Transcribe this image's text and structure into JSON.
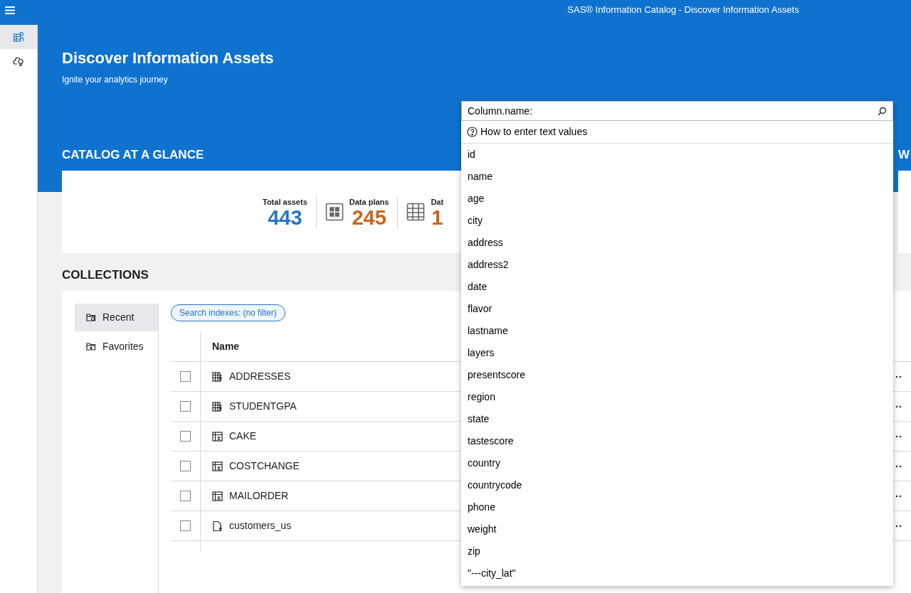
{
  "app_title": "SAS® Information Catalog - Discover Information Assets",
  "rail": [
    {
      "kind": "catalog",
      "selected": true
    },
    {
      "kind": "insight",
      "selected": false
    }
  ],
  "hero": {
    "title": "Discover Information Assets",
    "subtitle": "Ignite your analytics journey"
  },
  "glance": {
    "heading": "CATALOG AT A GLANCE",
    "stats": [
      {
        "label": "Total assets",
        "value": "443",
        "kind": "total"
      },
      {
        "label": "Data plans",
        "value": "245",
        "kind": "plans"
      },
      {
        "label": "Dat",
        "value": "1",
        "kind": "tables"
      }
    ]
  },
  "side_panel": {
    "heading": "W"
  },
  "collections": {
    "heading": "COLLECTIONS",
    "nav": [
      {
        "label": "Recent",
        "kind": "recent",
        "selected": true
      },
      {
        "label": "Favorites",
        "kind": "favorites",
        "selected": false
      }
    ],
    "filter_chip": "Search indexes: (no filter)",
    "table": {
      "columns": [
        "Name"
      ],
      "rows": [
        {
          "name": "ADDRESSES",
          "kind": "table-bolt",
          "checked": false
        },
        {
          "name": "STUDENTGPA",
          "kind": "table-bolt",
          "checked": false
        },
        {
          "name": "CAKE",
          "kind": "table-grid",
          "checked": false
        },
        {
          "name": "COSTCHANGE",
          "kind": "table-grid",
          "checked": false
        },
        {
          "name": "MAILORDER",
          "kind": "table-grid",
          "checked": false
        },
        {
          "name": "customers_us",
          "kind": "file",
          "checked": false
        }
      ]
    }
  },
  "search": {
    "value": "Column.name:",
    "help": "How to enter text values",
    "suggestions": [
      "id",
      "name",
      "age",
      "city",
      "address",
      "address2",
      "date",
      "flavor",
      "lastname",
      "layers",
      "presentscore",
      "region",
      "state",
      "tastescore",
      "country",
      "countrycode",
      "phone",
      "weight",
      "zip",
      "\"---city_lat\""
    ]
  }
}
